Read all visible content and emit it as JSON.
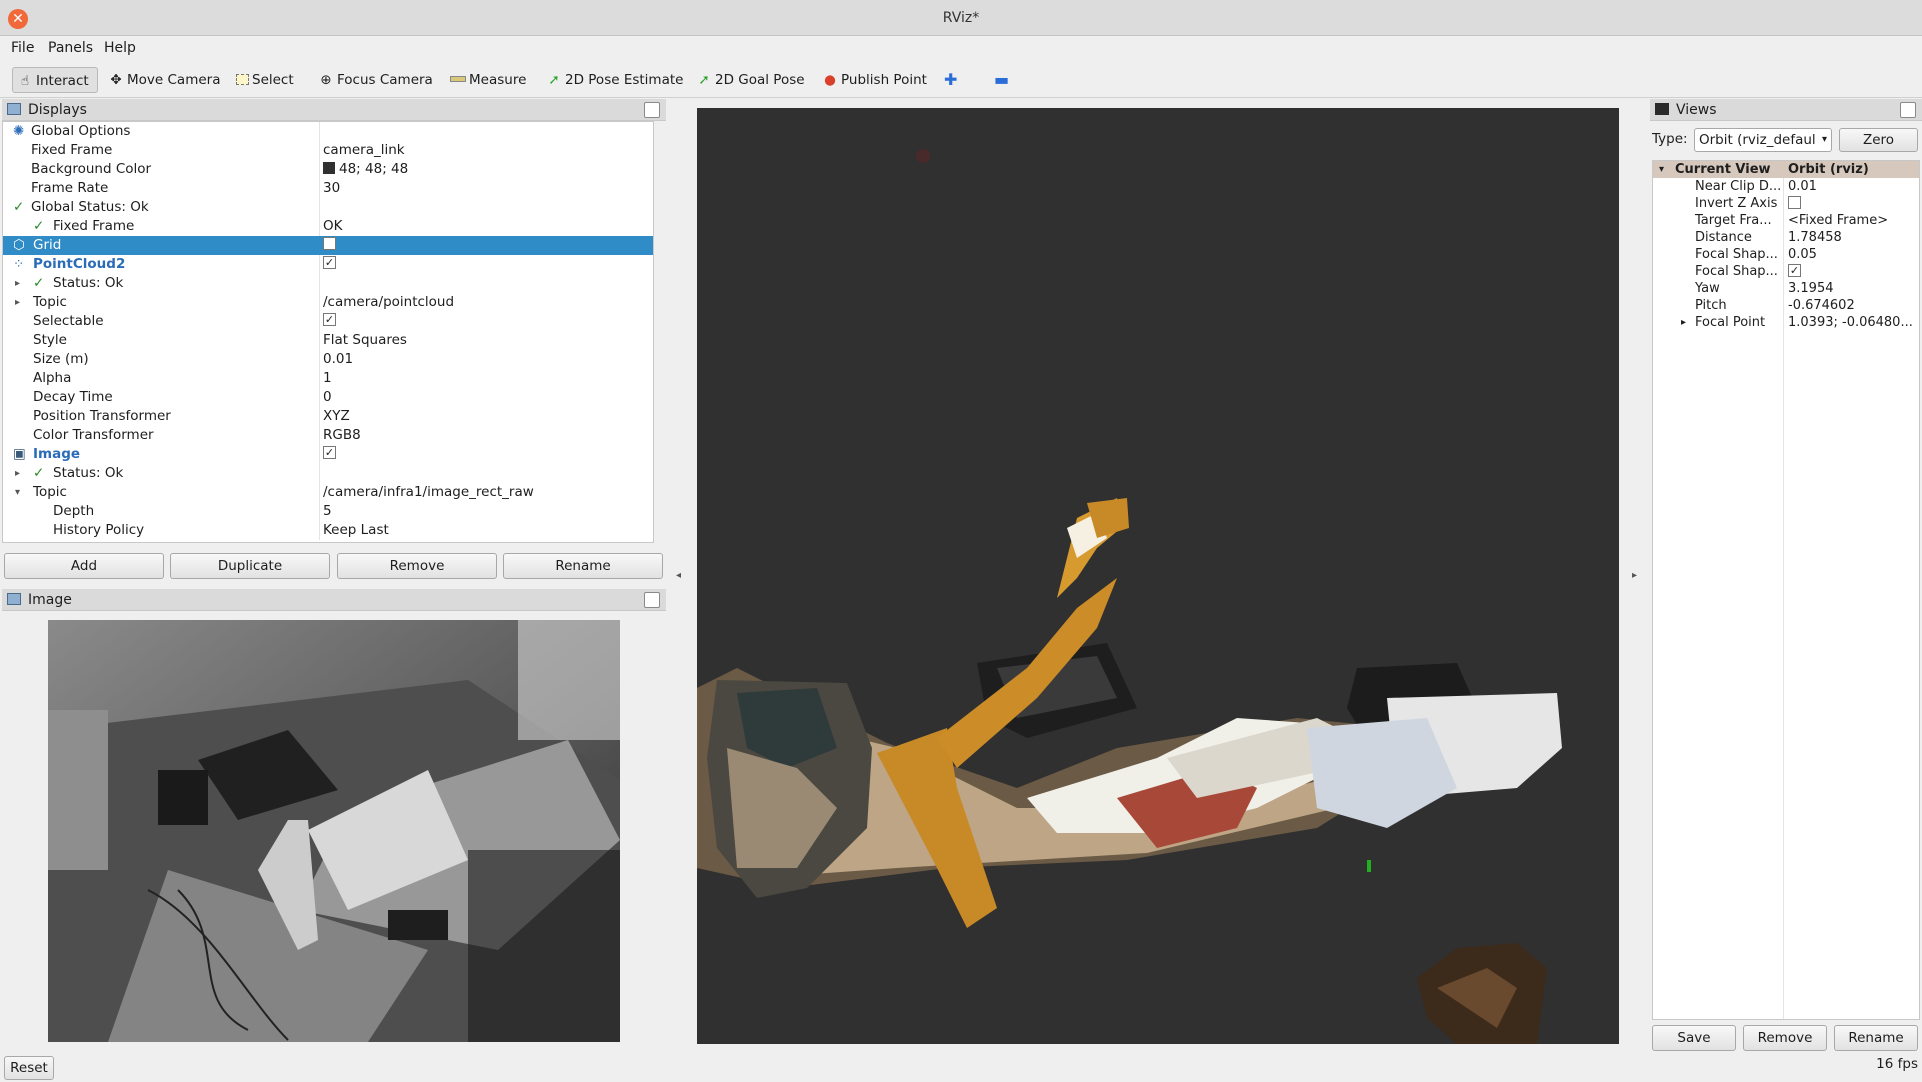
{
  "window": {
    "title": "RViz*"
  },
  "menu": [
    "File",
    "Panels",
    "Help"
  ],
  "toolbar": {
    "interact": "Interact",
    "move_camera": "Move Camera",
    "select": "Select",
    "focus_camera": "Focus Camera",
    "measure": "Measure",
    "pose_estimate": "2D Pose Estimate",
    "goal_pose": "2D Goal Pose",
    "publish_point": "Publish Point"
  },
  "displays": {
    "title": "Displays",
    "rows": {
      "global_options": "Global Options",
      "fixed_frame": "Fixed Frame",
      "fixed_frame_val": "camera_link",
      "background_color": "Background Color",
      "background_color_val": "48; 48; 48",
      "frame_rate": "Frame Rate",
      "frame_rate_val": "30",
      "global_status": "Global Status: Ok",
      "gs_fixed_frame": "Fixed Frame",
      "gs_fixed_frame_val": "OK",
      "grid": "Grid",
      "pointcloud2": "PointCloud2",
      "pc_status": "Status: Ok",
      "pc_topic": "Topic",
      "pc_topic_val": "/camera/pointcloud",
      "selectable": "Selectable",
      "style": "Style",
      "style_val": "Flat Squares",
      "size": "Size (m)",
      "size_val": "0.01",
      "alpha": "Alpha",
      "alpha_val": "1",
      "decay_time": "Decay Time",
      "decay_time_val": "0",
      "position_transformer": "Position Transformer",
      "position_transformer_val": "XYZ",
      "color_transformer": "Color Transformer",
      "color_transformer_val": "RGB8",
      "image": "Image",
      "img_status": "Status: Ok",
      "img_topic": "Topic",
      "img_topic_val": "/camera/infra1/image_rect_raw",
      "depth": "Depth",
      "depth_val": "5",
      "history_policy": "History Policy",
      "history_policy_val": "Keep Last"
    },
    "buttons": {
      "add": "Add",
      "duplicate": "Duplicate",
      "remove": "Remove",
      "rename": "Rename"
    }
  },
  "image_panel": {
    "title": "Image"
  },
  "views": {
    "title": "Views",
    "type_label": "Type:",
    "type_value": "Orbit (rviz_defaul",
    "zero": "Zero",
    "current_view": "Current View",
    "current_view_val": "Orbit (rviz)",
    "near_clip": "Near Clip D...",
    "near_clip_val": "0.01",
    "invert_z": "Invert Z Axis",
    "target_frame": "Target Fra...",
    "target_frame_val": "<Fixed Frame>",
    "distance": "Distance",
    "distance_val": "1.78458",
    "focal_shape_size": "Focal Shap...",
    "focal_shape_size_val": "0.05",
    "focal_shape_fixed": "Focal Shap...",
    "yaw": "Yaw",
    "yaw_val": "3.1954",
    "pitch": "Pitch",
    "pitch_val": "-0.674602",
    "focal_point": "Focal Point",
    "focal_point_val": "1.0393; -0.06480...",
    "buttons": {
      "save": "Save",
      "remove": "Remove",
      "rename": "Rename"
    }
  },
  "status": {
    "reset": "Reset",
    "fps": "16 fps"
  },
  "colors": {
    "selection": "#308cc6",
    "viewport_bg": "#303030",
    "views_header": "#d6c8bc"
  }
}
